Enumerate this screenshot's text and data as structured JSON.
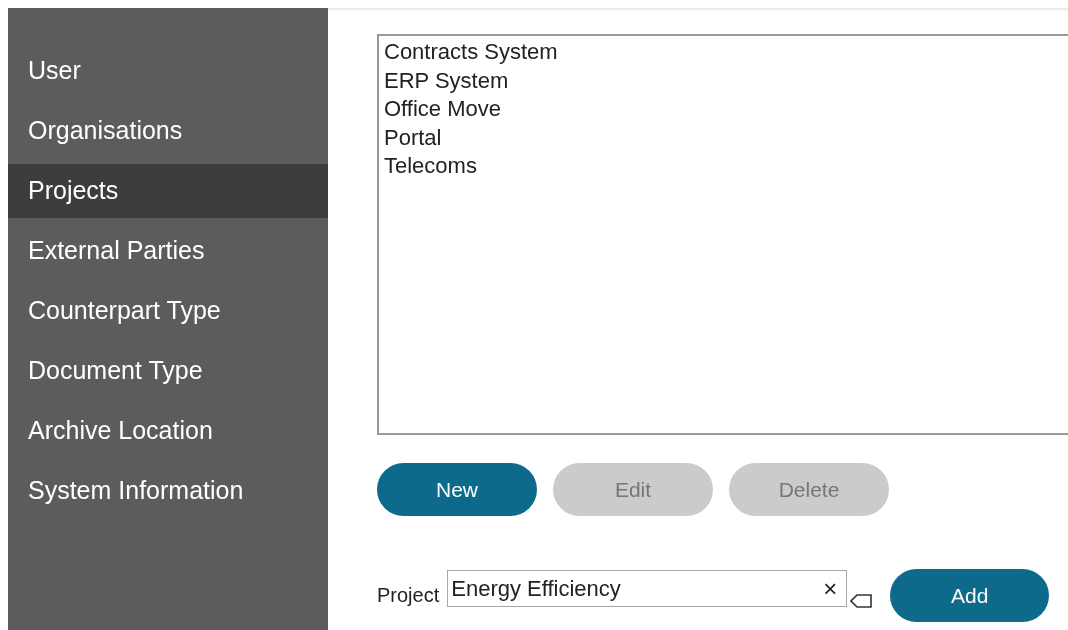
{
  "sidebar": {
    "items": [
      {
        "label": "User",
        "selected": false
      },
      {
        "label": "Organisations",
        "selected": false
      },
      {
        "label": "Projects",
        "selected": true
      },
      {
        "label": "External Parties",
        "selected": false
      },
      {
        "label": "Counterpart Type",
        "selected": false
      },
      {
        "label": "Document Type",
        "selected": false
      },
      {
        "label": "Archive Location",
        "selected": false
      },
      {
        "label": "System Information",
        "selected": false
      }
    ]
  },
  "project_list": {
    "items": [
      "Contracts System",
      "ERP System",
      "Office Move",
      "Portal",
      "Telecoms"
    ]
  },
  "buttons": [
    {
      "label": "New",
      "disabled": false
    },
    {
      "label": "Edit",
      "disabled": true
    },
    {
      "label": "Delete",
      "disabled": true
    }
  ],
  "project_field": {
    "label": "Project",
    "value": "Energy Efficiency",
    "clear": "×"
  },
  "add_button": {
    "label": "Add",
    "disabled": false
  }
}
